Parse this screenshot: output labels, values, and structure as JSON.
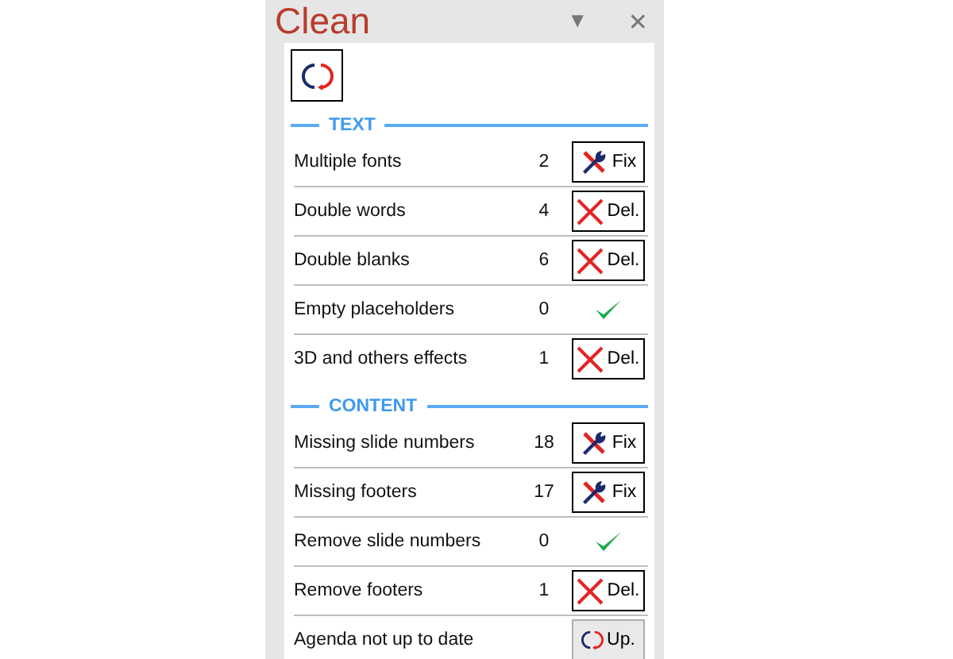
{
  "pane": {
    "title": "Clean",
    "menu_glyph": "▼",
    "close_glyph": "✕"
  },
  "sections": [
    {
      "title": "TEXT",
      "rows": [
        {
          "label": "Multiple fonts",
          "count": "2",
          "action": {
            "kind": "fix",
            "label": "Fix"
          }
        },
        {
          "label": "Double words",
          "count": "4",
          "action": {
            "kind": "del",
            "label": "Del."
          }
        },
        {
          "label": "Double blanks",
          "count": "6",
          "action": {
            "kind": "del",
            "label": "Del."
          }
        },
        {
          "label": "Empty placeholders",
          "count": "0",
          "action": {
            "kind": "ok"
          }
        },
        {
          "label": "3D and others effects",
          "count": "1",
          "action": {
            "kind": "del",
            "label": "Del."
          }
        }
      ]
    },
    {
      "title": "CONTENT",
      "rows": [
        {
          "label": "Missing slide numbers",
          "count": "18",
          "action": {
            "kind": "fix",
            "label": "Fix"
          }
        },
        {
          "label": "Missing footers",
          "count": "17",
          "action": {
            "kind": "fix",
            "label": "Fix"
          }
        },
        {
          "label": "Remove slide numbers",
          "count": "0",
          "action": {
            "kind": "ok"
          }
        },
        {
          "label": "Remove footers",
          "count": "1",
          "action": {
            "kind": "del",
            "label": "Del."
          }
        },
        {
          "label": "Agenda not up to date",
          "action": {
            "kind": "up",
            "label": "Up."
          }
        }
      ]
    }
  ]
}
